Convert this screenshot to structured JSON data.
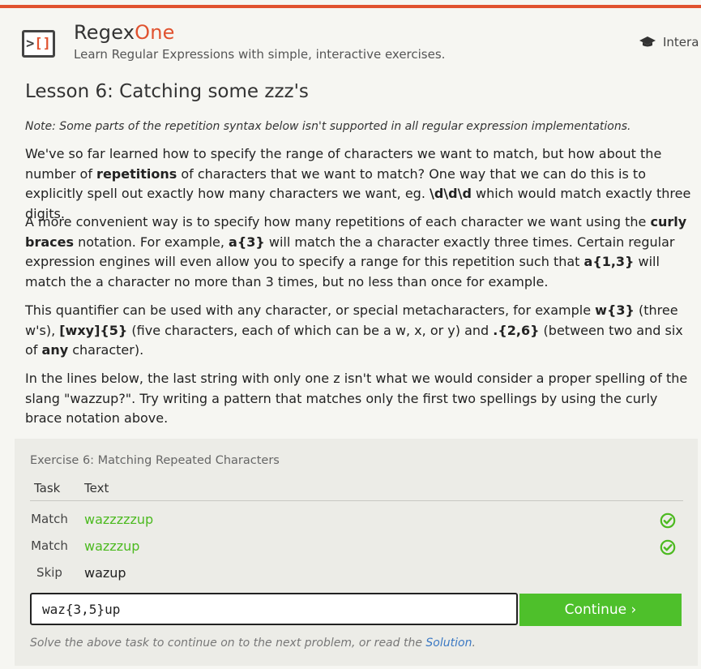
{
  "header": {
    "brand_main": "Regex",
    "brand_accent": "One",
    "tagline": "Learn Regular Expressions with simple, interactive exercises.",
    "logo_left": ">",
    "logo_right": "[]",
    "nav_partial": "Intera"
  },
  "lesson": {
    "title": "Lesson 6: Catching some zzz's",
    "note": "Note: Some parts of the repetition syntax below isn't supported in all regular expression implementations.",
    "p1": {
      "t1": "We've so far learned how to specify the range of characters we want to match, but how about the number of ",
      "b1": "repetitions",
      "t2": " of characters that we want to match? One way that we can do this is to explicitly spell out exactly how many characters we want, eg. ",
      "b2": "\\d\\d\\d",
      "t3": " which would match exactly three digits."
    },
    "p2": {
      "t1": "A more convenient way is to specify how many repetitions of each character we want using the ",
      "b1": "curly braces",
      "t2": " notation. For example, ",
      "b2": "a{3}",
      "t3": " will match the a character exactly three times. Certain regular expression engines will even allow you to specify a range for this repetition such that ",
      "b3": "a{1,3}",
      "t4": " will match the a character no more than 3 times, but no less than once for example."
    },
    "p3": {
      "t1": "This quantifier can be used with any character, or special metacharacters, for example ",
      "b1": "w{3}",
      "t2": " (three w's), ",
      "b2": "[wxy]{5}",
      "t3": " (five characters, each of which can be a w, x, or y) and ",
      "b3": ".{2,6}",
      "t4": " (between two and six of ",
      "b4": "any",
      "t5": " character)."
    },
    "p4": "In the lines below, the last string with only one z isn't what we would consider a proper spelling of the slang \"wazzup?\". Try writing a pattern that matches only the first two spellings by using the curly brace notation above."
  },
  "exercise": {
    "title": "Exercise 6: Matching Repeated Characters",
    "col_task": "Task",
    "col_text": "Text",
    "rows": [
      {
        "task": "Match",
        "text": "wazzzzzup",
        "status": "passed"
      },
      {
        "task": "Match",
        "text": "wazzzup",
        "status": "passed"
      },
      {
        "task": "Skip",
        "text": "wazup",
        "status": "none"
      }
    ],
    "input_value": "waz{3,5}up",
    "continue_label": "Continue ›",
    "footer_text": "Solve the above task to continue on to the next problem, or read the ",
    "solution_link": "Solution",
    "footer_end": "."
  },
  "colors": {
    "accent": "#e0522f",
    "match_green": "#4cba20",
    "button_green": "#4ec02b",
    "link_blue": "#3a78c3"
  }
}
